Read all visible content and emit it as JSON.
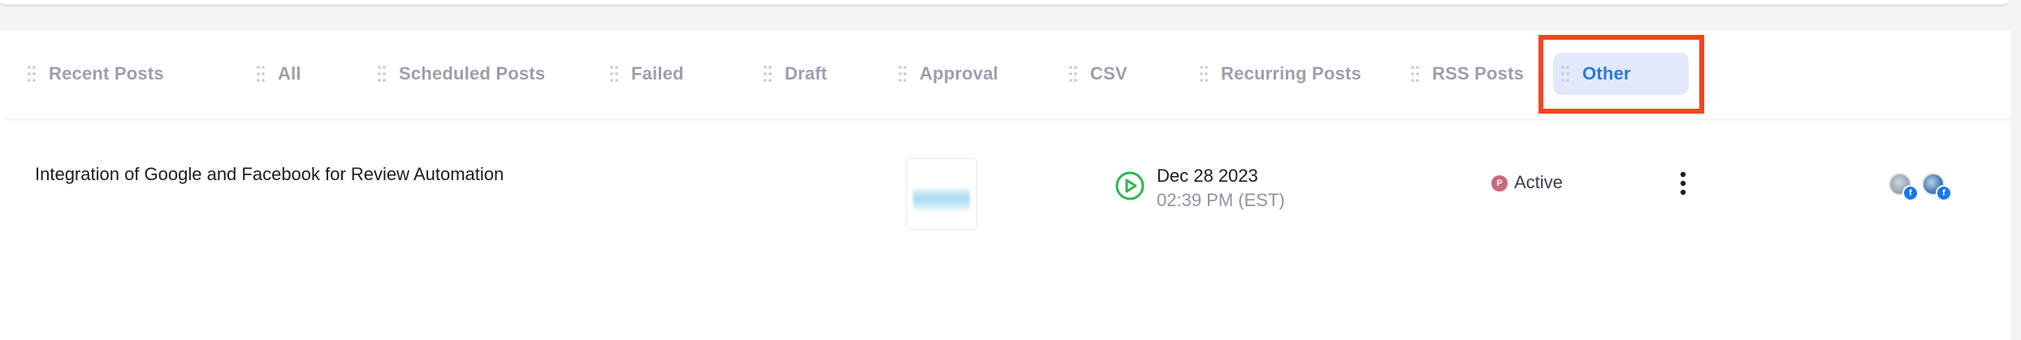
{
  "tabs": [
    {
      "label": "Recent Posts",
      "icon": "drag-handle-icon",
      "active": false
    },
    {
      "label": "All",
      "icon": "drag-handle-icon",
      "active": false
    },
    {
      "label": "Scheduled Posts",
      "icon": "drag-handle-icon",
      "active": false
    },
    {
      "label": "Failed",
      "icon": "drag-handle-icon",
      "active": false
    },
    {
      "label": "Draft",
      "icon": "drag-handle-icon",
      "active": false
    },
    {
      "label": "Approval",
      "icon": "drag-handle-icon",
      "active": false
    },
    {
      "label": "CSV",
      "icon": "drag-handle-icon",
      "active": false
    },
    {
      "label": "Recurring Posts",
      "icon": "drag-handle-icon",
      "active": false
    },
    {
      "label": "RSS Posts",
      "icon": "drag-handle-icon",
      "active": false
    },
    {
      "label": "Other",
      "icon": "drag-handle-icon",
      "active": true
    }
  ],
  "posts": [
    {
      "title": "Integration of Google and Facebook for Review Automation",
      "thumbnail_icon": "post-image-thumbnail",
      "date": "Dec 28 2023",
      "time": "02:39 PM (EST)",
      "status_badge": "P",
      "status": "Active",
      "menu_icon": "more-vertical-icon",
      "accounts": [
        {
          "avatar": "account-avatar",
          "network": "f"
        },
        {
          "avatar": "account-avatar",
          "network": "f"
        }
      ]
    }
  ],
  "colors": {
    "accent": "#2a78e4",
    "active_tab_bg": "#e3e9fb",
    "highlight": "#f0471e",
    "published_green": "#2fb552",
    "status_dot": "#c8697a",
    "facebook": "#1877f2"
  }
}
